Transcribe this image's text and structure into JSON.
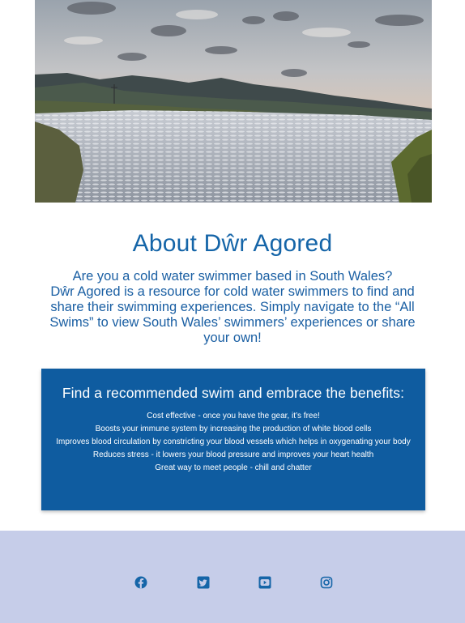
{
  "hero": {
    "image": "lake-landscape-photo"
  },
  "about": {
    "title": "About Dŵr Agored",
    "intro": "Are you a cold water swimmer based in South Wales?",
    "description": "Dŵr Agored is a resource for cold water swimmers to find and share their swimming experiences. Simply navigate to the “All Swims” to view South Wales’ swimmers’ experiences or share your own!"
  },
  "benefits": {
    "title": "Find a recommended swim and embrace the benefits:",
    "items": [
      "Cost effective - once you have the gear, it’s free!",
      "Boosts your immune system by increasing the production of white blood cells",
      "Improves blood circulation by constricting your blood vessels which helps in oxygenating your body",
      "Reduces stress - it lowers your blood pressure and improves your heart health",
      "Great way to meet people - chill and chatter"
    ]
  },
  "footer": {
    "social_icons": [
      "facebook-icon",
      "twitter-icon",
      "youtube-icon",
      "instagram-icon"
    ]
  },
  "colors": {
    "accent_blue": "#1565a8",
    "card_blue": "#0f5ca0",
    "footer_bg": "#c6cde9"
  }
}
